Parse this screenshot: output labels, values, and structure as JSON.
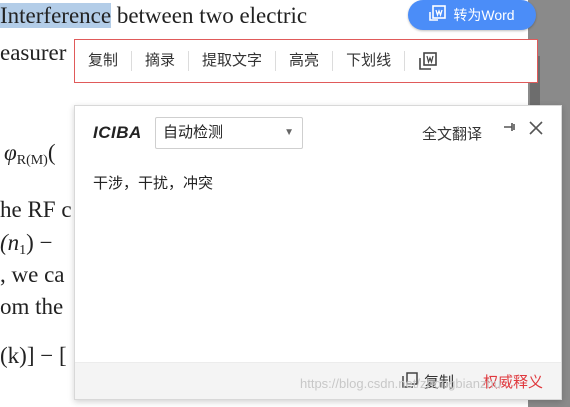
{
  "document": {
    "line1_highlight": "Interference",
    "line1_rest": " between two electric",
    "line2": "easurer",
    "phi_symbol": "φ",
    "phi_sub": "R(M)",
    "phi_tail": "(",
    "line4": "he RF c",
    "line5": "(n",
    "line5_sub": "1",
    "line5_tail": ") −",
    "line6": ", we ca",
    "line7": "om the",
    "line8": "(k)] − ["
  },
  "word_button": {
    "label": "转为Word",
    "icon": "word-convert-icon"
  },
  "toolbar": {
    "items": [
      "复制",
      "摘录",
      "提取文字",
      "高亮",
      "下划线"
    ],
    "trailing_icon": "extract-icon"
  },
  "panel": {
    "brand": "ICIBA",
    "language": "自动检测",
    "full_translate": "全文翻译",
    "pin_icon": "pin-icon",
    "close_icon": "close-icon",
    "result": "干涉，干扰，冲突",
    "footer": {
      "copy_label": "复制",
      "authority_label": "权威释义"
    }
  },
  "watermark": "https://blog.csdn.net/zhongbianzhu"
}
